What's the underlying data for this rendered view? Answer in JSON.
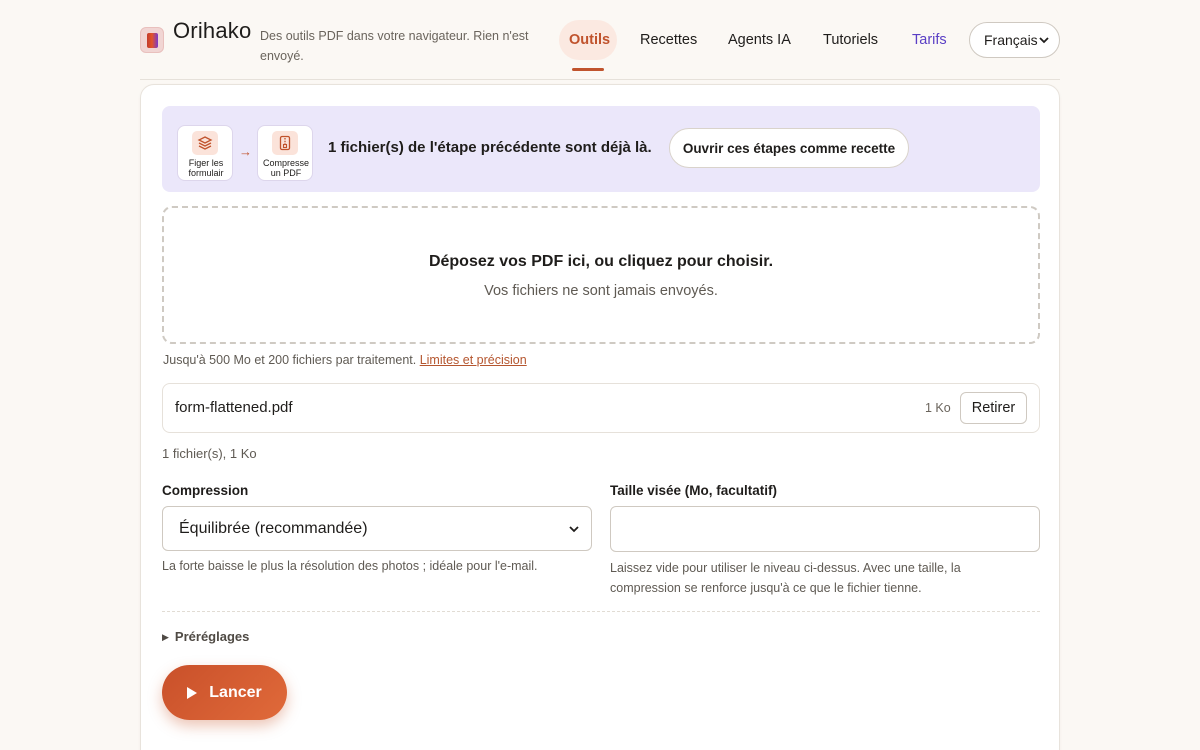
{
  "header": {
    "brand": "Orihako",
    "tagline": "Des outils PDF dans votre navigateur. Rien n'est envoyé.",
    "nav": [
      {
        "label": "Outils",
        "active": true
      },
      {
        "label": "Recettes"
      },
      {
        "label": "Agents IA"
      },
      {
        "label": "Tutoriels"
      },
      {
        "label": "Tarifs"
      }
    ],
    "language": "Français"
  },
  "banner": {
    "steps": [
      {
        "label": "Figer les formulair",
        "icon": "layers-icon"
      },
      {
        "label": "Compresse un PDF",
        "icon": "file-zip-icon"
      }
    ],
    "text": "1 fichier(s) de l'étape précédente sont déjà là.",
    "button": "Ouvrir ces étapes comme recette"
  },
  "dropzone": {
    "title": "Déposez vos PDF ici, ou cliquez pour choisir.",
    "subtitle": "Vos fichiers ne sont jamais envoyés."
  },
  "limits": {
    "text": "Jusqu'à 500 Mo et 200 fichiers par traitement.",
    "link": "Limites et précision"
  },
  "files": [
    {
      "name": "form-flattened.pdf",
      "size": "1 Ko",
      "remove": "Retirer"
    }
  ],
  "summary": "1 fichier(s), 1 Ko",
  "compression": {
    "label": "Compression",
    "value": "Équilibrée (recommandée)",
    "help": "La forte baisse le plus la résolution des photos ; idéale pour l'e-mail."
  },
  "target_size": {
    "label": "Taille visée (Mo, facultatif)",
    "value": "",
    "help": "Laissez vide pour utiliser le niveau ci-dessus. Avec une taille, la compression se renforce jusqu'à ce que le fichier tienne."
  },
  "presets": "Préréglages",
  "run": "Lancer",
  "colors": {
    "accent": "#c0532d",
    "banner_bg": "#ebe7fa",
    "tarifs": "#5a3fc5"
  }
}
